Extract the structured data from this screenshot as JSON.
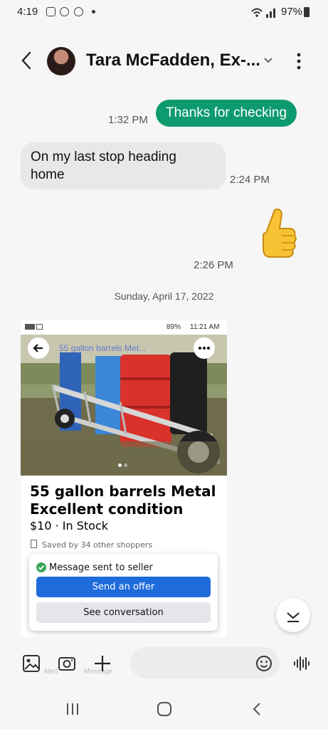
{
  "status_bar": {
    "time": "4:19",
    "battery": "97%"
  },
  "header": {
    "contact_name": "Tara McFadden, Ex-..."
  },
  "messages": [
    {
      "direction": "out",
      "text": "Thanks for checking",
      "time": "1:32 PM"
    },
    {
      "direction": "in",
      "text_line1": "On my last stop heading",
      "text_line2": "home",
      "time": "2:24 PM"
    },
    {
      "direction": "out",
      "emoji": "thumbs-up",
      "time": "2:26 PM"
    }
  ],
  "date_separator": "Sunday, April 17, 2022",
  "shared_screenshot": {
    "status": {
      "battery": "89%",
      "time": "11:21 AM"
    },
    "search_text": "55 gallon barrels Met...",
    "listing_title_line1": "55 gallon barrels Metal",
    "listing_title_line2": "Excellent condition",
    "price_line": "$10 · In Stock",
    "saved_text": "Saved by 34 other shoppers",
    "popup": {
      "message": "Message sent to seller",
      "offer_button": "Send an offer",
      "conversation_button": "See conversation"
    },
    "ghost_labels": {
      "alert": "Alert",
      "message": "Message"
    }
  },
  "colors": {
    "outgoing_bubble": "#0d9a6e",
    "incoming_bubble": "#e8e8e8",
    "offer_button": "#1e6bdb"
  }
}
